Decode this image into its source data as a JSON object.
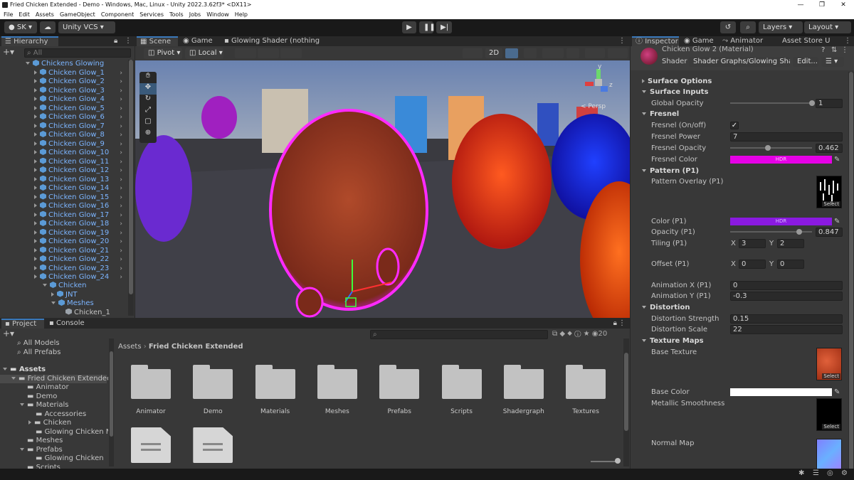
{
  "window": {
    "title": "Fried Chicken Extended - Demo - Windows, Mac, Linux - Unity 2022.3.62f3* <DX11>",
    "controls": [
      "—",
      "❐",
      "✕"
    ]
  },
  "menu": [
    "File",
    "Edit",
    "Assets",
    "GameObject",
    "Component",
    "Services",
    "Tools",
    "Jobs",
    "Window",
    "Help"
  ],
  "toolbar": {
    "account": "SK",
    "vcs": "Unity VCS",
    "layers": "Layers",
    "layout": "Layout"
  },
  "hierarchy": {
    "tab": "Hierarchy",
    "search_placeholder": "All",
    "root": "Chickens Glowing",
    "items": [
      "Chicken Glow_1",
      "Chicken Glow_2",
      "Chicken Glow_3",
      "Chicken Glow_4",
      "Chicken Glow_5",
      "Chicken Glow_6",
      "Chicken Glow_7",
      "Chicken Glow_8",
      "Chicken Glow_9",
      "Chicken Glow_10",
      "Chicken Glow_11",
      "Chicken Glow_12",
      "Chicken Glow_13",
      "Chicken Glow_14",
      "Chicken Glow_15",
      "Chicken Glow_16",
      "Chicken Glow_17",
      "Chicken Glow_18",
      "Chicken Glow_19",
      "Chicken Glow_20",
      "Chicken Glow_21",
      "Chicken Glow_22",
      "Chicken Glow_23",
      "Chicken Glow_24"
    ],
    "child": "Chicken",
    "sub": [
      "JNT",
      "Meshes"
    ],
    "leaf": "Chicken_1"
  },
  "scene": {
    "tabs": [
      "Scene",
      "Game",
      "Glowing Shader (nothing l..."
    ],
    "pivot": "Pivot",
    "local": "Local",
    "mode2d": "2D",
    "persp": "< Persp",
    "gizmo": {
      "y": "y",
      "z": "z"
    }
  },
  "project": {
    "tabs": [
      "Project",
      "Console"
    ],
    "favorites": [
      "All Models",
      "All Prefabs"
    ],
    "assets_root": "Assets",
    "tree": [
      {
        "label": "Fried Chicken Extended",
        "indent": 1,
        "open": true
      },
      {
        "label": "Animator",
        "indent": 2
      },
      {
        "label": "Demo",
        "indent": 2
      },
      {
        "label": "Materials",
        "indent": 2,
        "open": true
      },
      {
        "label": "Accessories",
        "indent": 3
      },
      {
        "label": "Chicken",
        "indent": 3,
        "closed": true
      },
      {
        "label": "Glowing Chicken Ma",
        "indent": 3
      },
      {
        "label": "Meshes",
        "indent": 2
      },
      {
        "label": "Prefabs",
        "indent": 2,
        "open": true
      },
      {
        "label": "Glowing Chicken",
        "indent": 3
      },
      {
        "label": "Scripts",
        "indent": 2
      }
    ],
    "breadcrumb": [
      "Assets",
      "Fried Chicken Extended"
    ],
    "folders": [
      "Animator",
      "Demo",
      "Materials",
      "Meshes",
      "Prefabs",
      "Scripts",
      "Shadergraph",
      "Textures"
    ],
    "count": "20"
  },
  "inspector": {
    "tabs": [
      "Inspector",
      "Game",
      "Animator",
      "Asset Store U"
    ],
    "material": "Chicken Glow 2 (Material)",
    "shader_label": "Shader",
    "shader": "Shader Graphs/Glowing Shad",
    "edit": "Edit...",
    "sections": {
      "surface_options": "Surface Options",
      "surface_inputs": "Surface Inputs",
      "fresnel": "Fresnel",
      "pattern": "Pattern (P1)",
      "distortion": "Distortion",
      "texture_maps": "Texture Maps"
    },
    "global_opacity": {
      "label": "Global Opacity",
      "value": "1",
      "fraction": 1.0
    },
    "fresnel_onoff": {
      "label": "Fresnel (On/off)",
      "checked": true
    },
    "fresnel_power": {
      "label": "Fresnel Power",
      "value": "7"
    },
    "fresnel_opacity": {
      "label": "Fresnel Opacity",
      "value": "0.462",
      "fraction": 0.462
    },
    "fresnel_color": {
      "label": "Fresnel Color",
      "color": "#e600e6",
      "badge": "HDR"
    },
    "pattern_overlay": {
      "label": "Pattern Overlay (P1)",
      "select": "Select"
    },
    "color_p1": {
      "label": "Color (P1)",
      "color": "#8a1ae0",
      "badge": "HDR"
    },
    "opacity_p1": {
      "label": "Opacity (P1)",
      "value": "0.847",
      "fraction": 0.847
    },
    "tiling_p1": {
      "label": "Tiling (P1)",
      "x": "3",
      "y": "2"
    },
    "offset_p1": {
      "label": "Offset (P1)",
      "x": "0",
      "y": "0"
    },
    "anim_x": {
      "label": "Animation X (P1)",
      "value": "0"
    },
    "anim_y": {
      "label": "Animation Y (P1)",
      "value": "-0.3"
    },
    "dist_strength": {
      "label": "Distortion Strength",
      "value": "0.15"
    },
    "dist_scale": {
      "label": "Distortion Scale",
      "value": "22"
    },
    "base_texture": {
      "label": "Base Texture",
      "select": "Select"
    },
    "base_color": {
      "label": "Base Color",
      "color": "#ffffff"
    },
    "metallic": {
      "label": "Metallic Smoothness",
      "select": "Select"
    },
    "normal": {
      "label": "Normal Map"
    },
    "xy": {
      "x": "X",
      "y": "Y"
    }
  }
}
